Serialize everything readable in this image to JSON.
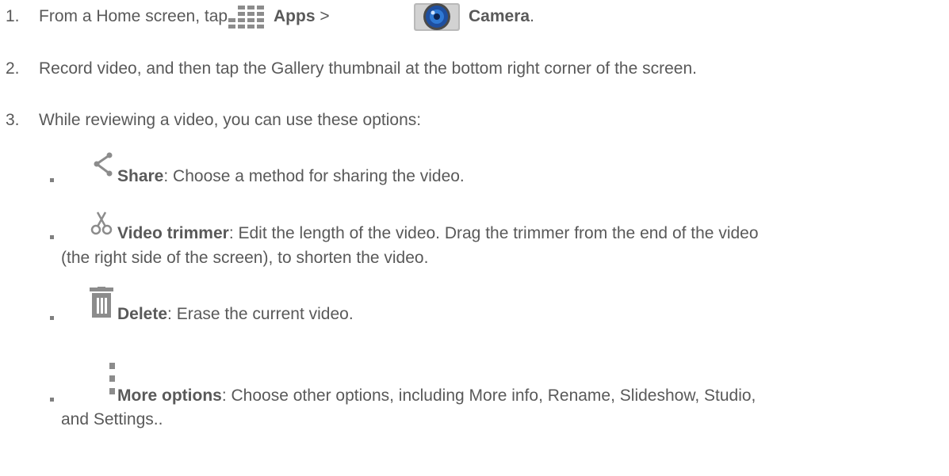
{
  "steps": [
    {
      "number": "1.",
      "text_before": "From a Home screen, tap ",
      "apps_label": "Apps",
      "separator": " > ",
      "camera_label": "Camera",
      "end": "."
    },
    {
      "number": "2.",
      "text": "Record video, and then tap the Gallery thumbnail at the bottom right corner of the screen."
    },
    {
      "number": "3.",
      "text": "While reviewing a video, you can use these options:"
    }
  ],
  "options": [
    {
      "icon": "share-icon",
      "label": "Share",
      "desc": ": Choose a method for sharing the video."
    },
    {
      "icon": "scissors-icon",
      "label": "Video trimmer",
      "desc": ": Edit the length of the video. Drag the trimmer from the end of the video",
      "desc2": "(the right side of the screen), to shorten the video."
    },
    {
      "icon": "trash-icon",
      "label": "Delete",
      "desc": ": Erase the current video."
    },
    {
      "icon": "more-options-icon",
      "label": "More options",
      "desc": ": Choose other options, including More info, Rename, Slideshow, Studio,",
      "desc2": "and Settings.."
    }
  ],
  "colors": {
    "text": "#595959",
    "icon_gray": "#808080",
    "camera_blue": "#1e4fa0"
  }
}
